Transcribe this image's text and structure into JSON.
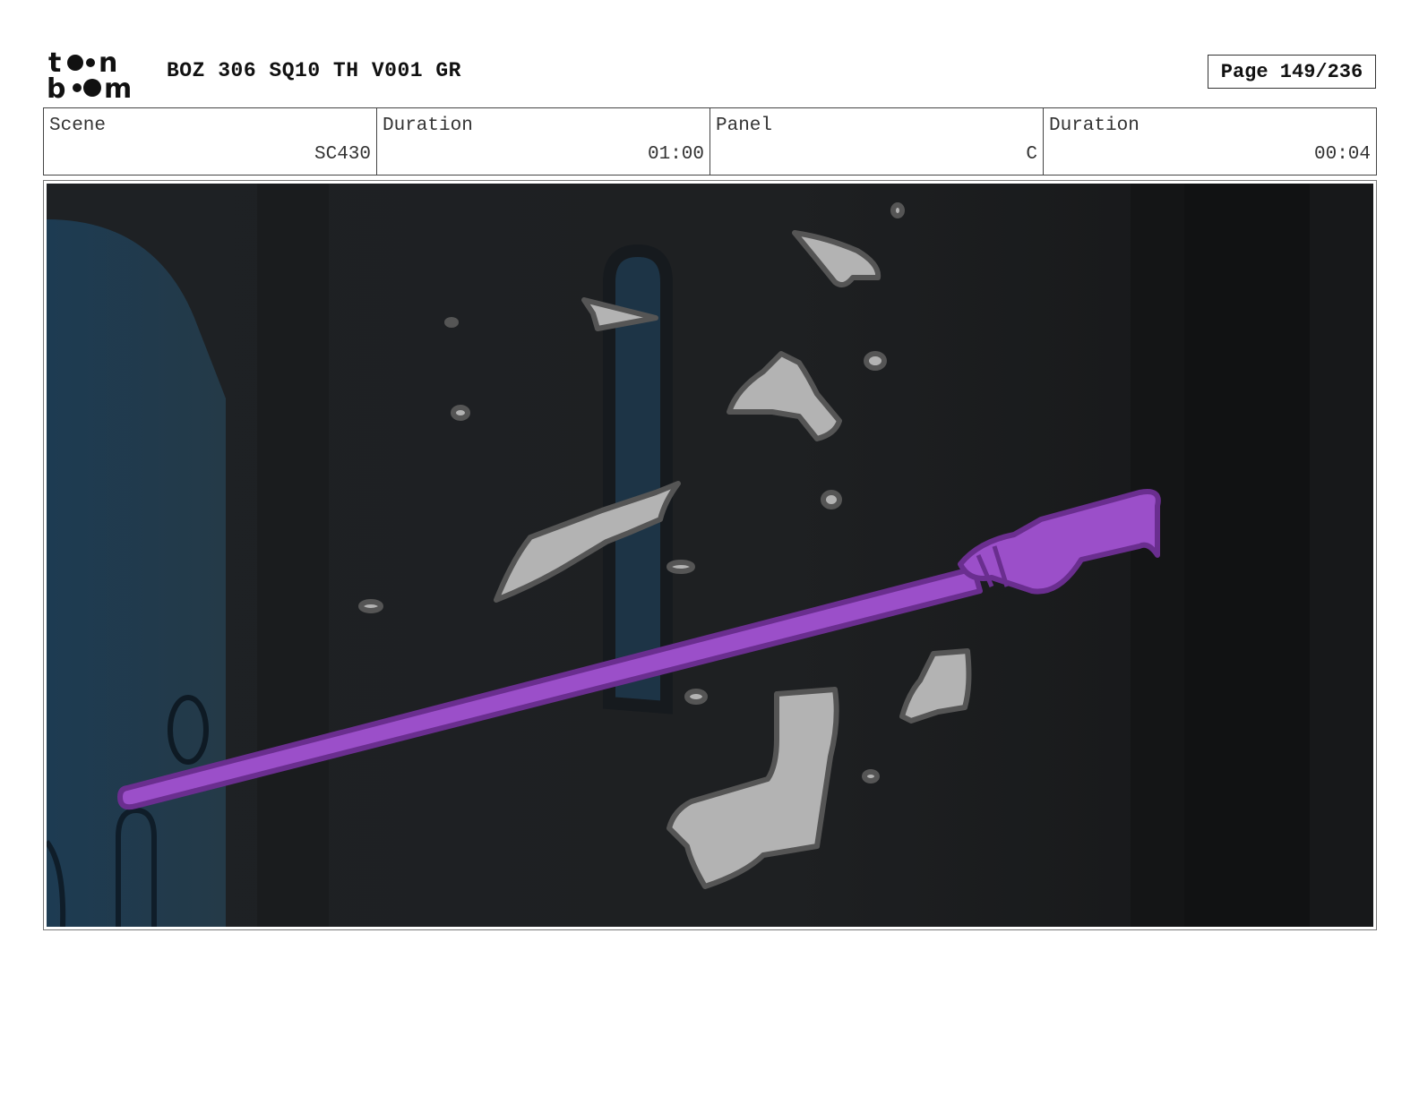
{
  "header": {
    "logo_text": "toon boom",
    "title": "BOZ 306 SQ10 TH V001 GR",
    "page": "Page 149/236"
  },
  "info": {
    "scene_label": "Scene",
    "scene_value": "SC430",
    "scene_duration_label": "Duration",
    "scene_duration_value": "01:00",
    "panel_label": "Panel",
    "panel_value": "C",
    "panel_duration_label": "Duration",
    "panel_duration_value": "00:04"
  },
  "colors": {
    "wand": "#9b4fc9",
    "wand_outline": "#6a2e8f",
    "shard_fill": "#b3b3b3",
    "shard_outline": "#555555",
    "background": "#1c1d1f",
    "window": "#1f3a4d"
  }
}
